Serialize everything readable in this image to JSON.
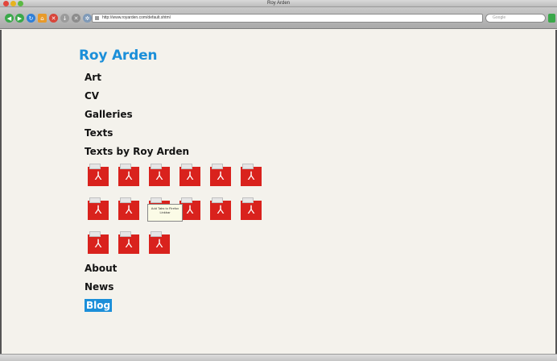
{
  "window": {
    "title": "Roy Arden"
  },
  "toolbar": {
    "address": "http://www.royarden.com/default.shtml",
    "search_placeholder": "Google"
  },
  "site": {
    "title": "Roy Arden",
    "nav_top": [
      "Art",
      "CV",
      "Galleries",
      "Texts",
      "Texts by Roy Arden"
    ],
    "nav_bottom": [
      "About",
      "News",
      "Blog"
    ],
    "active_item": "Blog"
  },
  "pdf_icons": {
    "count": 15,
    "icon": "pdf-document-icon"
  },
  "tooltip": {
    "text": "Add Tabs to Firefox Linkbar"
  },
  "colors": {
    "accent": "#1b8fd9",
    "pdf_red": "#d9221d",
    "background": "#f4f2ec"
  }
}
